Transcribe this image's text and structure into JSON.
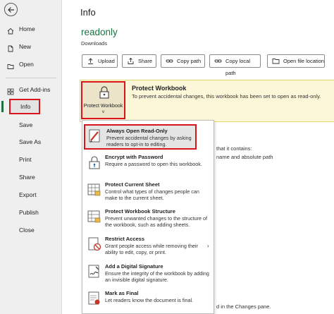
{
  "nav": {
    "items": [
      {
        "label": "Home"
      },
      {
        "label": "New"
      },
      {
        "label": "Open"
      },
      {
        "label": "Get Add-ins"
      },
      {
        "label": "Info"
      },
      {
        "label": "Save"
      },
      {
        "label": "Save As"
      },
      {
        "label": "Print"
      },
      {
        "label": "Share"
      },
      {
        "label": "Export"
      },
      {
        "label": "Publish"
      },
      {
        "label": "Close"
      }
    ]
  },
  "main": {
    "title": "Info",
    "file_name": "readonly",
    "file_location": "Downloads",
    "buttons": [
      {
        "label": "Upload",
        "icon": "upload-icon"
      },
      {
        "label": "Share",
        "icon": "share-icon"
      },
      {
        "label": "Copy path",
        "icon": "link-icon"
      },
      {
        "label": "Copy local path",
        "icon": "link-icon"
      },
      {
        "label": "Open file location",
        "icon": "folder-icon"
      }
    ],
    "protect": {
      "tile_label": "Protect Workbook ˅",
      "title": "Protect Workbook",
      "description": "To prevent accidental changes, this workbook has been set to open as read-only."
    },
    "background_fragments": [
      "that it contains:",
      "name and absolute path",
      "d in the Changes pane."
    ]
  },
  "menu": {
    "items": [
      {
        "title": "Always Open Read-Only",
        "desc": "Prevent accidental changes by asking readers to opt-in to editing.",
        "icon": "read-only-pencil-icon"
      },
      {
        "title": "Encrypt with Password",
        "desc": "Require a password to open this workbook.",
        "icon": "lock-key-icon"
      },
      {
        "title": "Protect Current Sheet",
        "desc": "Control what types of changes people can make to the current sheet.",
        "icon": "sheet-lock-icon"
      },
      {
        "title": "Protect Workbook Structure",
        "desc": "Prevent unwanted changes to the structure of the workbook, such as adding sheets.",
        "icon": "workbook-lock-icon"
      },
      {
        "title": "Restrict Access",
        "desc": "Grant people access while removing their ability to edit, copy, or print.",
        "icon": "restrict-access-icon"
      },
      {
        "title": "Add a Digital Signature",
        "desc": "Ensure the integrity of the workbook by adding an invisible digital signature.",
        "icon": "signature-icon"
      },
      {
        "title": "Mark as Final",
        "desc": "Let readers know the document is final.",
        "icon": "mark-final-icon"
      }
    ]
  }
}
